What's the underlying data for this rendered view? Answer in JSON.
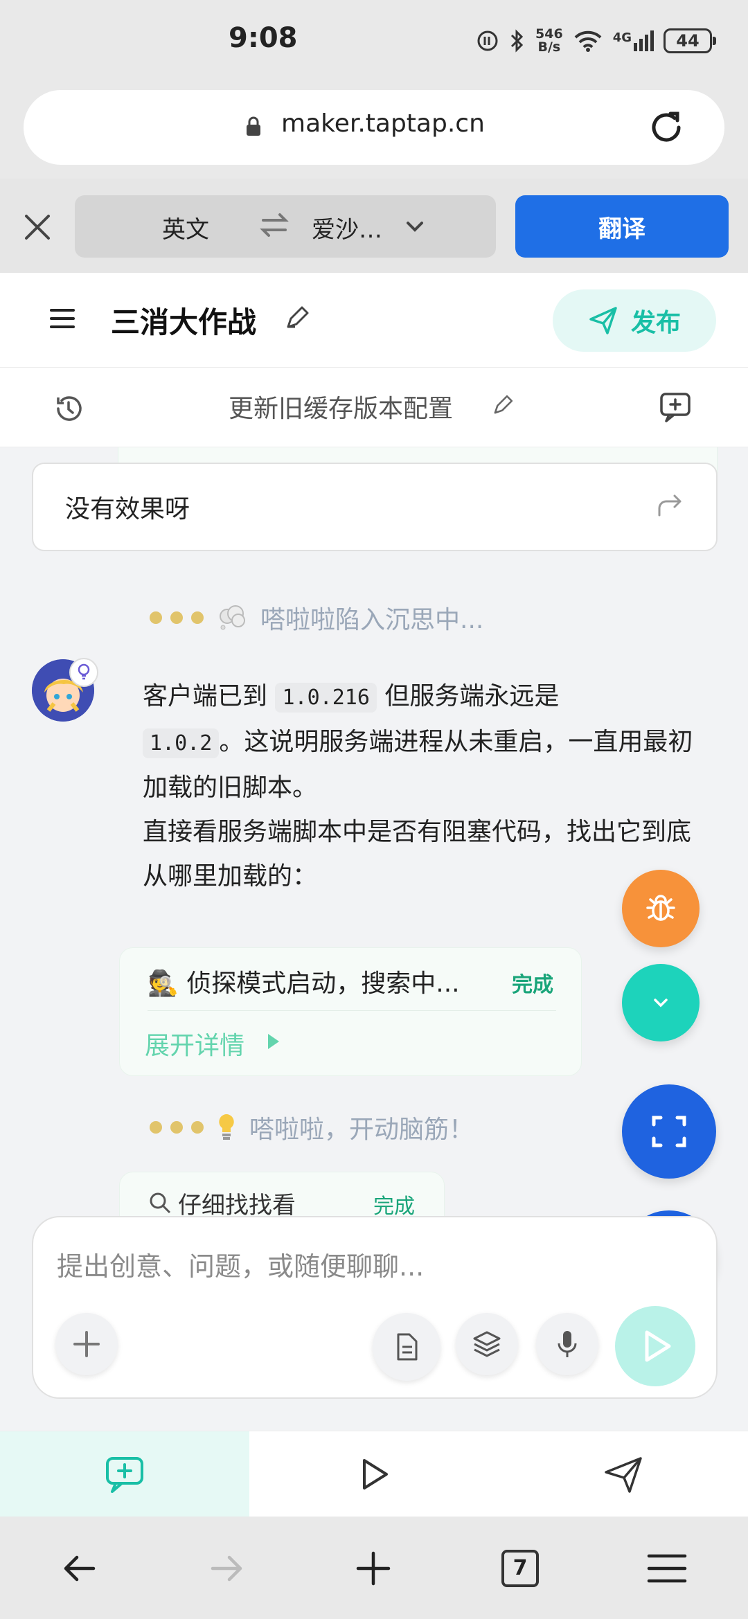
{
  "status_bar": {
    "time": "9:08",
    "net_speed_value": "546",
    "net_speed_unit": "B/s",
    "network": "4G",
    "battery": "44"
  },
  "browser": {
    "url": "maker.taptap.cn"
  },
  "translate_bar": {
    "source_lang": "英文",
    "target_lang": "爱沙…",
    "translate_label": "翻译"
  },
  "app_header": {
    "title": "三消大作战",
    "publish_label": "发布"
  },
  "sub_header": {
    "version_title": "更新旧缓存版本配置"
  },
  "chat": {
    "user_message": "没有效果呀",
    "thinking_1": "嗒啦啦陷入沉思中...",
    "assistant": {
      "line1_pre": "客户端已到 ",
      "code1": "1.0.216",
      "line1_post": " 但服务端永远是",
      "code2": "1.0.2",
      "line2_post": "。这说明服务端进程从未重启，一直用最初加载的旧脚本。",
      "line3": "直接看服务端脚本中是否有阻塞代码，找出它到底从哪里加载的："
    },
    "detail_card": {
      "title": "侦探模式启动，搜索中...",
      "status": "完成",
      "expand_label": "展开详情"
    },
    "thinking_2": "嗒啦啦，开动脑筋！",
    "cut_card": {
      "title": "仔细找找看",
      "status": "完成"
    }
  },
  "input": {
    "placeholder": "提出创意、问题，或随便聊聊..."
  },
  "nav": {
    "tab_count": "7"
  },
  "colors": {
    "accent": "#1dd3bb",
    "primary": "#1f63e0",
    "bug": "#f7923a"
  }
}
